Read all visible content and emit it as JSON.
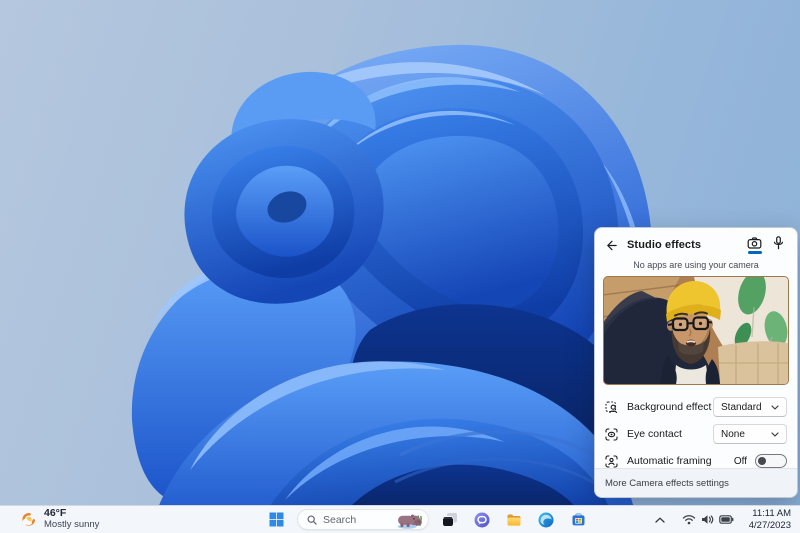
{
  "desktop": {
    "wallpaper": "Windows 11 blue bloom"
  },
  "studio_effects_panel": {
    "title": "Studio effects",
    "status_text": "No apps are using your camera",
    "camera_preview_alt": "Man wearing yellow beanie and black glasses leaning toward camera",
    "rows": [
      {
        "icon": "background-effect-icon",
        "label": "Background effect",
        "control": "dropdown",
        "value": "Standard"
      },
      {
        "icon": "eye-contact-icon",
        "label": "Eye contact",
        "control": "dropdown",
        "value": "None"
      },
      {
        "icon": "automatic-framing-icon",
        "label": "Automatic framing",
        "control": "toggle",
        "value": "Off",
        "state": "off"
      }
    ],
    "footer_link": "More Camera effects settings",
    "accent_color": "#0067c0"
  },
  "taskbar": {
    "widget": {
      "icon": "weather-mostly-sunny-icon",
      "temperature": "46°F",
      "condition": "Mostly sunny"
    },
    "search": {
      "icon": "search-icon",
      "label": "Search",
      "decoration": "hippo-daily-image"
    },
    "app_icons": [
      "windows-start",
      "task-view",
      "chat",
      "file-explorer",
      "edge",
      "microsoft-store"
    ],
    "tray": {
      "icons": [
        "hidden-icons-chevron",
        "wifi",
        "volume",
        "battery"
      ],
      "time": "11:11 AM",
      "date": "4/27/2023"
    }
  }
}
